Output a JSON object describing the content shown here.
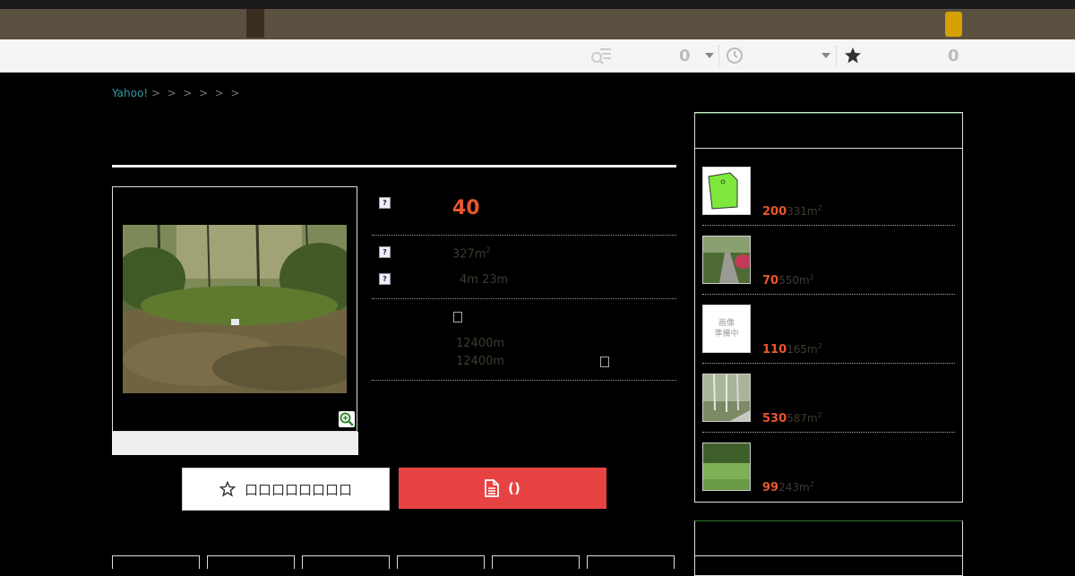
{
  "header": {
    "toolbar": {
      "search_history_count": "0",
      "recent_count": "0",
      "favorites_count": "0"
    }
  },
  "breadcrumb": {
    "home": "Yahoo!",
    "separators": [
      ">",
      ">",
      ">",
      ">",
      ">",
      ">"
    ]
  },
  "listing": {
    "price": "40",
    "area_value": "327m",
    "area_sup": "2",
    "road_access": "4m 23m",
    "station_line_1": "12400m",
    "station_line_2": "12400m"
  },
  "actions": {
    "favorite_label": "口口口口口口口口",
    "request_label": "()"
  },
  "sidebar": {
    "items": [
      {
        "price": "200",
        "area": "331m",
        "sup": "2",
        "thumb": "map"
      },
      {
        "price": "70",
        "area": "550m",
        "sup": "2",
        "thumb": "photo-road"
      },
      {
        "price": "110",
        "area": "165m",
        "sup": "2",
        "thumb": "placeholder",
        "placeholder_text": "画像\n準備中"
      },
      {
        "price": "530",
        "area": "587m",
        "sup": "2",
        "thumb": "photo-forest"
      },
      {
        "price": "99",
        "area": "243m",
        "sup": "2",
        "thumb": "photo-field"
      }
    ]
  },
  "colors": {
    "accent_price": "#e8562e",
    "request_button": "#e84343",
    "topbar": "#5b5140",
    "link": "#2f9aa3"
  }
}
